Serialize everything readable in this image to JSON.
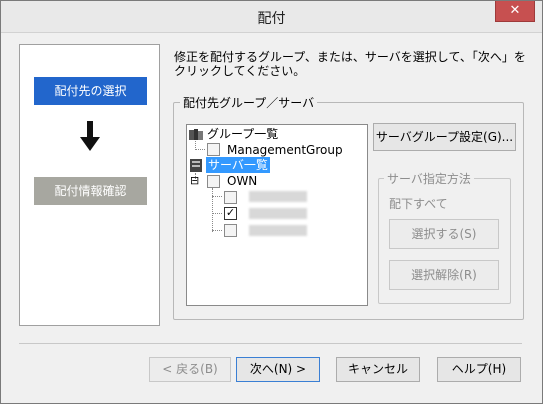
{
  "window": {
    "title": "配付",
    "close_glyph": "✕"
  },
  "steps": {
    "active": "配付先の選択",
    "inactive": "配付情報確認"
  },
  "instruction": "修正を配付するグループ、または、サーバを選択して、「次へ」をクリックしてください。",
  "group_box": {
    "label": "配付先グループ／サーバ"
  },
  "tree": {
    "group_list_label": "グループ一覧",
    "group_item": "ManagementGroup",
    "server_list_label": "サーバ一覧",
    "own_label": "OWN",
    "server_items": [
      {
        "checked": false
      },
      {
        "checked": true,
        "check_glyph": "✓"
      },
      {
        "checked": false
      }
    ],
    "expander": "⊟"
  },
  "buttons": {
    "server_group_settings": "サーバグループ設定(G)...",
    "select": "選択する(S)",
    "deselect": "選択解除(R)",
    "back": "< 戻る(B)",
    "next": "次へ(N) >",
    "cancel": "キャンセル",
    "help": "ヘルプ(H)"
  },
  "server_spec": {
    "label": "サーバ指定方法",
    "sub_text": "配下すべて"
  }
}
